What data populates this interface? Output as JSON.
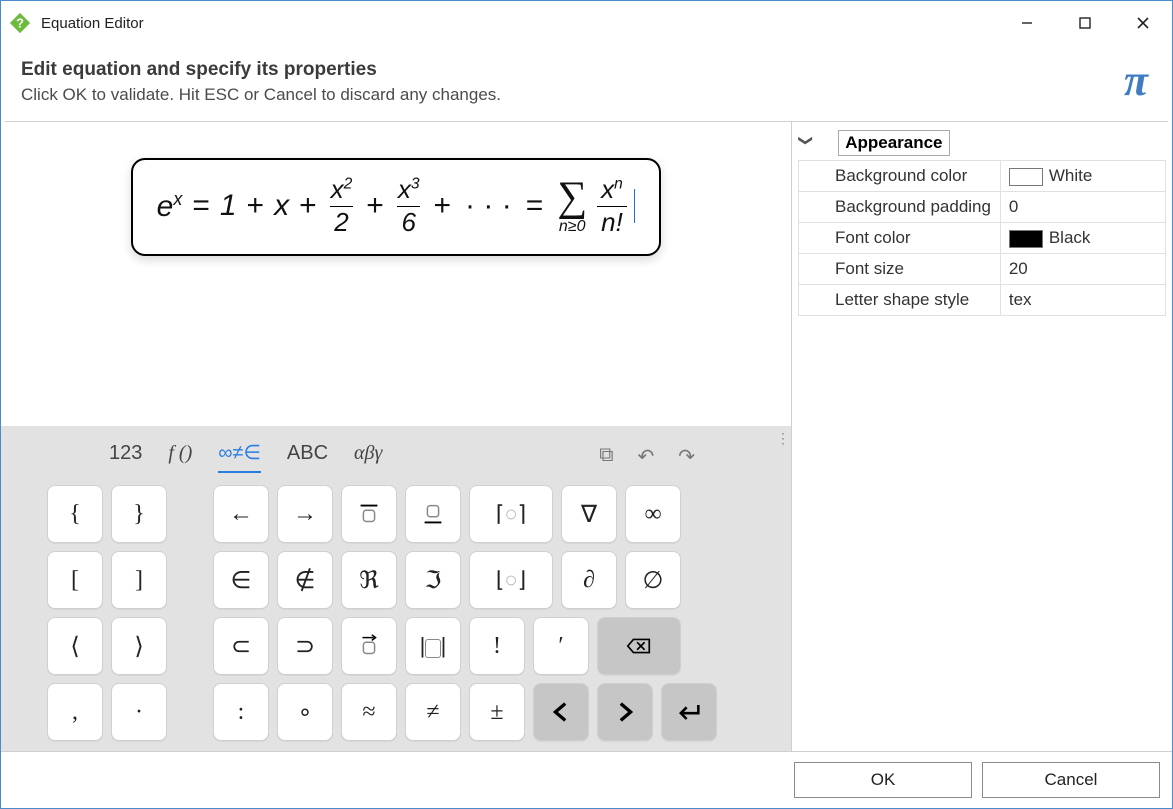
{
  "window": {
    "title": "Equation Editor"
  },
  "header": {
    "title": "Edit equation and specify its properties",
    "subtitle": "Click OK to validate. Hit ESC or Cancel to discard any changes.",
    "logo_char": "π"
  },
  "equation": {
    "lhs_base": "e",
    "lhs_exp": "x",
    "eq": "=",
    "t1": "1",
    "plus": "+",
    "t2": "x",
    "f1_num_base": "x",
    "f1_num_exp": "2",
    "f1_den": "2",
    "f2_num_base": "x",
    "f2_num_exp": "3",
    "f2_den": "6",
    "dots": "· · ·",
    "sum_sub": "n≥0",
    "rhs_num_base": "x",
    "rhs_num_exp": "n",
    "rhs_den": "n!"
  },
  "tabs": {
    "numeric": "123",
    "func": "f ()",
    "symbols": "∞≠∈",
    "alpha": "ABC",
    "greek": "αβγ"
  },
  "keys": {
    "r1": [
      "{",
      "}",
      "←",
      "→",
      "▭̄",
      "▭̲",
      "⌈◦⌉",
      "∇",
      "∞"
    ],
    "r2": [
      "[",
      "]",
      "∈",
      "∉",
      "ℜ",
      "ℑ",
      "⌊◦⌋",
      "∂",
      "∅"
    ],
    "r3": [
      "⟨",
      "⟩",
      "⊂",
      "⊃",
      "▭⃗",
      "|▭|",
      "!",
      "′",
      "⌫"
    ],
    "r4": [
      ",",
      "·",
      ":",
      "∘",
      "≈",
      "≠",
      "±",
      "‹",
      "›",
      "↵"
    ]
  },
  "properties": {
    "section": "Appearance",
    "rows": [
      {
        "label": "Background color",
        "value": "White",
        "swatch": "#ffffff"
      },
      {
        "label": "Background padding",
        "value": "0"
      },
      {
        "label": "Font color",
        "value": "Black",
        "swatch": "#000000"
      },
      {
        "label": "Font size",
        "value": "20"
      },
      {
        "label": "Letter shape style",
        "value": "tex"
      }
    ]
  },
  "footer": {
    "ok": "OK",
    "cancel": "Cancel"
  }
}
